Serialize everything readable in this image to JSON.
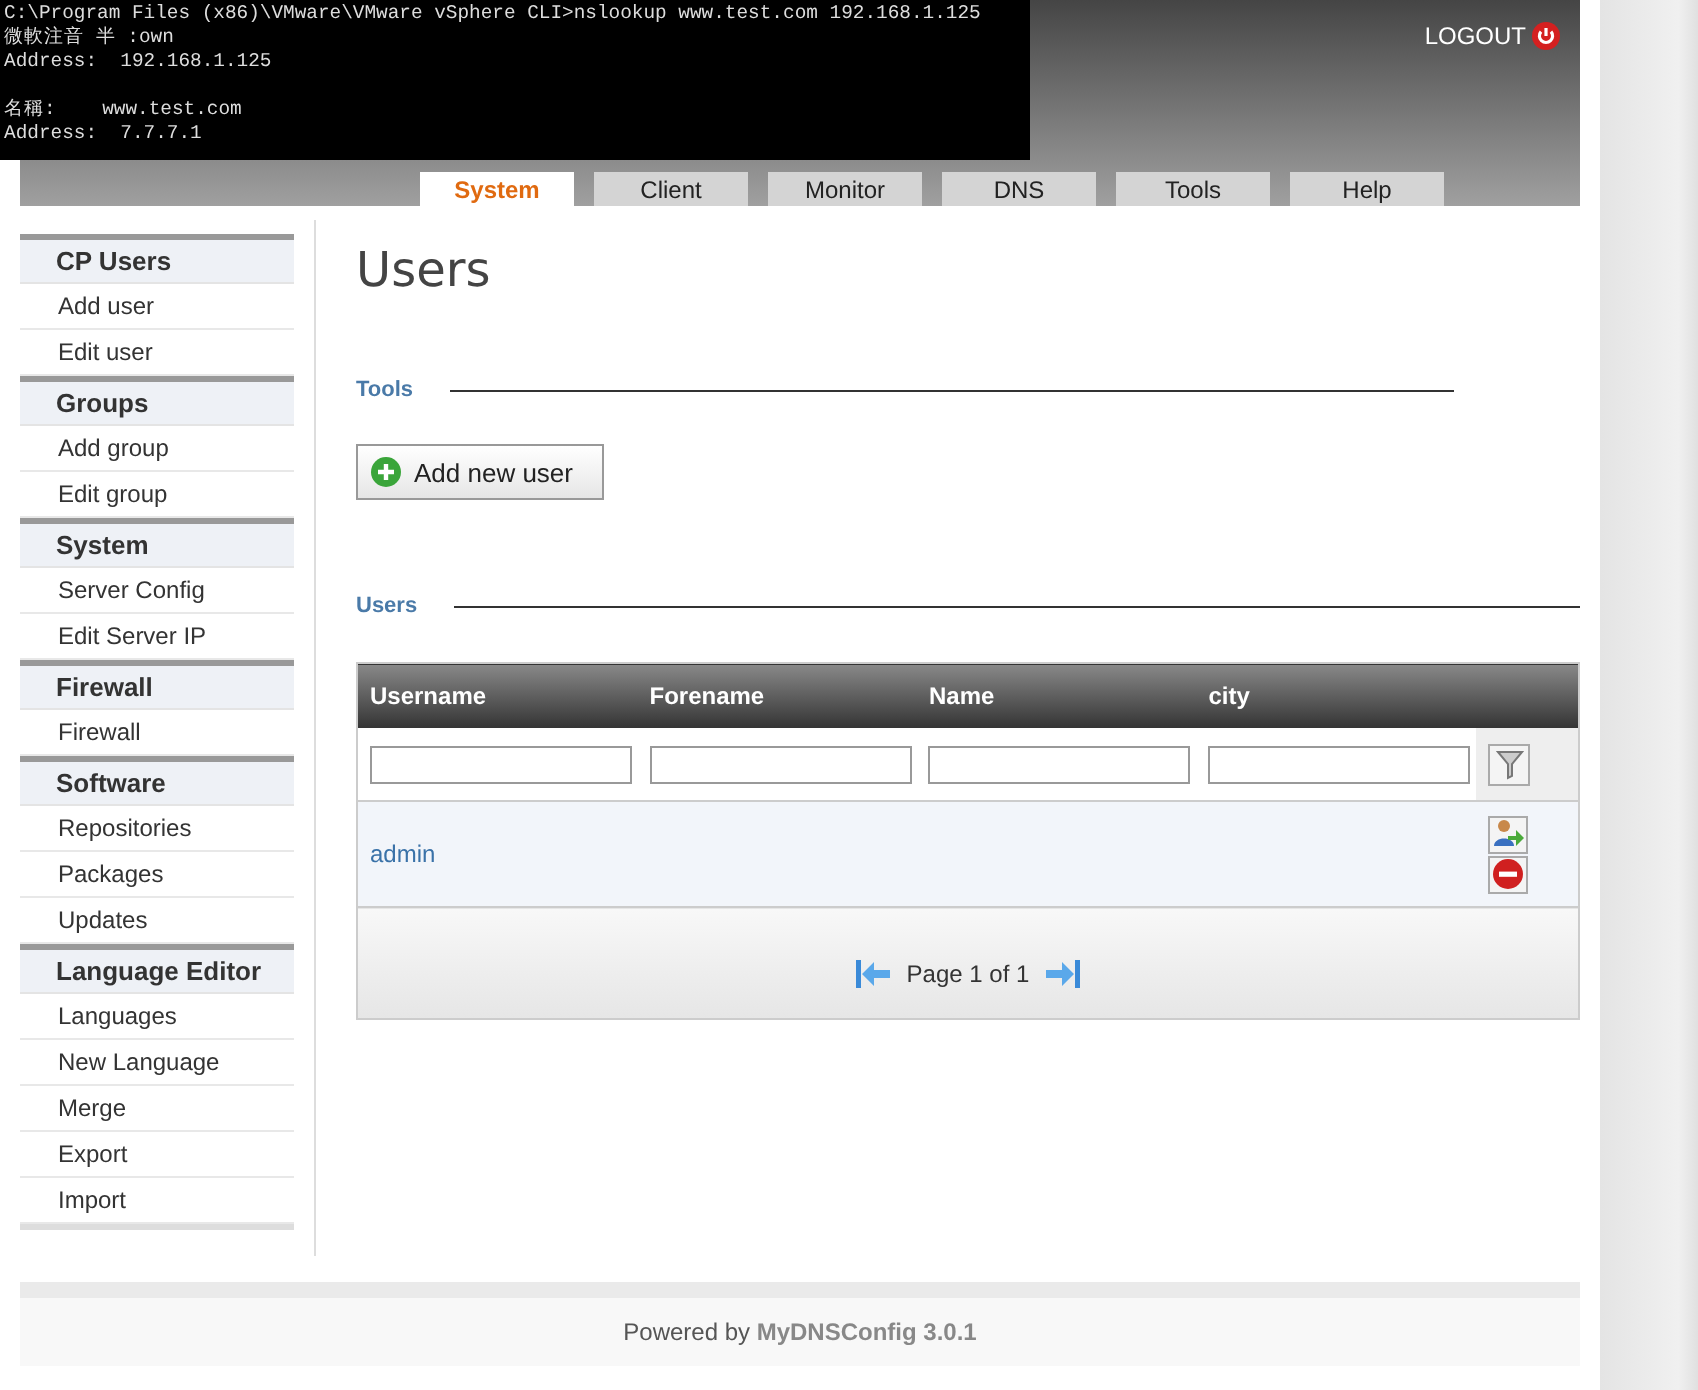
{
  "console": {
    "blocks": [
      [
        "C:\\Program Files (x86)\\VMware\\VMware vSphere CLI>nslookup www.test.com 192.168.1.125",
        "微軟注音 半 :own",
        "Address:  192.168.1.125"
      ],
      [
        "名稱:    www.test.com",
        "Address:  7.7.7.1"
      ]
    ]
  },
  "header": {
    "logout": "LOGOUT"
  },
  "tabs": [
    {
      "label": "System",
      "selected": true
    },
    {
      "label": "Client",
      "selected": false
    },
    {
      "label": "Monitor",
      "selected": false
    },
    {
      "label": "DNS",
      "selected": false
    },
    {
      "label": "Tools",
      "selected": false
    },
    {
      "label": "Help",
      "selected": false
    }
  ],
  "sidebar": {
    "sections": [
      {
        "title": "CP Users",
        "items": [
          "Add user",
          "Edit user"
        ]
      },
      {
        "title": "Groups",
        "items": [
          "Add group",
          "Edit group"
        ]
      },
      {
        "title": "System",
        "items": [
          "Server Config",
          "Edit Server IP"
        ]
      },
      {
        "title": "Firewall",
        "items": [
          "Firewall"
        ]
      },
      {
        "title": "Software",
        "items": [
          "Repositories",
          "Packages",
          "Updates"
        ]
      },
      {
        "title": "Language Editor",
        "items": [
          "Languages",
          "New Language",
          "Merge",
          "Export",
          "Import"
        ]
      }
    ]
  },
  "page": {
    "title": "Users",
    "tools_legend": "Tools",
    "add_button": "Add new user",
    "users_legend": "Users"
  },
  "table": {
    "columns": [
      "Username",
      "Forename",
      "Name",
      "city"
    ],
    "rows": [
      {
        "username": "admin"
      }
    ],
    "pager": "Page 1 of 1"
  },
  "footer": "Powered by **MyDNSConfig 3.0.1**"
}
